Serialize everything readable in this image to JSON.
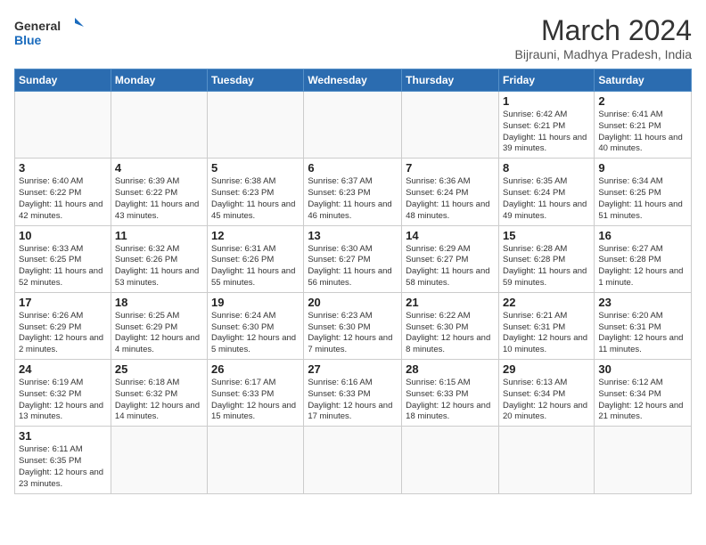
{
  "header": {
    "logo_general": "General",
    "logo_blue": "Blue",
    "month_title": "March 2024",
    "subtitle": "Bijrauni, Madhya Pradesh, India"
  },
  "days_of_week": [
    "Sunday",
    "Monday",
    "Tuesday",
    "Wednesday",
    "Thursday",
    "Friday",
    "Saturday"
  ],
  "weeks": [
    [
      {
        "day": "",
        "info": ""
      },
      {
        "day": "",
        "info": ""
      },
      {
        "day": "",
        "info": ""
      },
      {
        "day": "",
        "info": ""
      },
      {
        "day": "",
        "info": ""
      },
      {
        "day": "1",
        "info": "Sunrise: 6:42 AM\nSunset: 6:21 PM\nDaylight: 11 hours\nand 39 minutes."
      },
      {
        "day": "2",
        "info": "Sunrise: 6:41 AM\nSunset: 6:21 PM\nDaylight: 11 hours\nand 40 minutes."
      }
    ],
    [
      {
        "day": "3",
        "info": "Sunrise: 6:40 AM\nSunset: 6:22 PM\nDaylight: 11 hours\nand 42 minutes."
      },
      {
        "day": "4",
        "info": "Sunrise: 6:39 AM\nSunset: 6:22 PM\nDaylight: 11 hours\nand 43 minutes."
      },
      {
        "day": "5",
        "info": "Sunrise: 6:38 AM\nSunset: 6:23 PM\nDaylight: 11 hours\nand 45 minutes."
      },
      {
        "day": "6",
        "info": "Sunrise: 6:37 AM\nSunset: 6:23 PM\nDaylight: 11 hours\nand 46 minutes."
      },
      {
        "day": "7",
        "info": "Sunrise: 6:36 AM\nSunset: 6:24 PM\nDaylight: 11 hours\nand 48 minutes."
      },
      {
        "day": "8",
        "info": "Sunrise: 6:35 AM\nSunset: 6:24 PM\nDaylight: 11 hours\nand 49 minutes."
      },
      {
        "day": "9",
        "info": "Sunrise: 6:34 AM\nSunset: 6:25 PM\nDaylight: 11 hours\nand 51 minutes."
      }
    ],
    [
      {
        "day": "10",
        "info": "Sunrise: 6:33 AM\nSunset: 6:25 PM\nDaylight: 11 hours\nand 52 minutes."
      },
      {
        "day": "11",
        "info": "Sunrise: 6:32 AM\nSunset: 6:26 PM\nDaylight: 11 hours\nand 53 minutes."
      },
      {
        "day": "12",
        "info": "Sunrise: 6:31 AM\nSunset: 6:26 PM\nDaylight: 11 hours\nand 55 minutes."
      },
      {
        "day": "13",
        "info": "Sunrise: 6:30 AM\nSunset: 6:27 PM\nDaylight: 11 hours\nand 56 minutes."
      },
      {
        "day": "14",
        "info": "Sunrise: 6:29 AM\nSunset: 6:27 PM\nDaylight: 11 hours\nand 58 minutes."
      },
      {
        "day": "15",
        "info": "Sunrise: 6:28 AM\nSunset: 6:28 PM\nDaylight: 11 hours\nand 59 minutes."
      },
      {
        "day": "16",
        "info": "Sunrise: 6:27 AM\nSunset: 6:28 PM\nDaylight: 12 hours\nand 1 minute."
      }
    ],
    [
      {
        "day": "17",
        "info": "Sunrise: 6:26 AM\nSunset: 6:29 PM\nDaylight: 12 hours\nand 2 minutes."
      },
      {
        "day": "18",
        "info": "Sunrise: 6:25 AM\nSunset: 6:29 PM\nDaylight: 12 hours\nand 4 minutes."
      },
      {
        "day": "19",
        "info": "Sunrise: 6:24 AM\nSunset: 6:30 PM\nDaylight: 12 hours\nand 5 minutes."
      },
      {
        "day": "20",
        "info": "Sunrise: 6:23 AM\nSunset: 6:30 PM\nDaylight: 12 hours\nand 7 minutes."
      },
      {
        "day": "21",
        "info": "Sunrise: 6:22 AM\nSunset: 6:30 PM\nDaylight: 12 hours\nand 8 minutes."
      },
      {
        "day": "22",
        "info": "Sunrise: 6:21 AM\nSunset: 6:31 PM\nDaylight: 12 hours\nand 10 minutes."
      },
      {
        "day": "23",
        "info": "Sunrise: 6:20 AM\nSunset: 6:31 PM\nDaylight: 12 hours\nand 11 minutes."
      }
    ],
    [
      {
        "day": "24",
        "info": "Sunrise: 6:19 AM\nSunset: 6:32 PM\nDaylight: 12 hours\nand 13 minutes."
      },
      {
        "day": "25",
        "info": "Sunrise: 6:18 AM\nSunset: 6:32 PM\nDaylight: 12 hours\nand 14 minutes."
      },
      {
        "day": "26",
        "info": "Sunrise: 6:17 AM\nSunset: 6:33 PM\nDaylight: 12 hours\nand 15 minutes."
      },
      {
        "day": "27",
        "info": "Sunrise: 6:16 AM\nSunset: 6:33 PM\nDaylight: 12 hours\nand 17 minutes."
      },
      {
        "day": "28",
        "info": "Sunrise: 6:15 AM\nSunset: 6:33 PM\nDaylight: 12 hours\nand 18 minutes."
      },
      {
        "day": "29",
        "info": "Sunrise: 6:13 AM\nSunset: 6:34 PM\nDaylight: 12 hours\nand 20 minutes."
      },
      {
        "day": "30",
        "info": "Sunrise: 6:12 AM\nSunset: 6:34 PM\nDaylight: 12 hours\nand 21 minutes."
      }
    ],
    [
      {
        "day": "31",
        "info": "Sunrise: 6:11 AM\nSunset: 6:35 PM\nDaylight: 12 hours\nand 23 minutes."
      },
      {
        "day": "",
        "info": ""
      },
      {
        "day": "",
        "info": ""
      },
      {
        "day": "",
        "info": ""
      },
      {
        "day": "",
        "info": ""
      },
      {
        "day": "",
        "info": ""
      },
      {
        "day": "",
        "info": ""
      }
    ]
  ]
}
